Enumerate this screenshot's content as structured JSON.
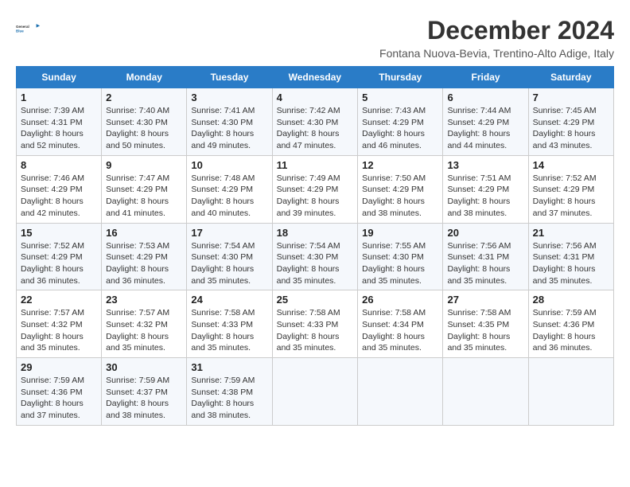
{
  "logo": {
    "line1": "General",
    "line2": "Blue"
  },
  "title": "December 2024",
  "subtitle": "Fontana Nuova-Bevia, Trentino-Alto Adige, Italy",
  "days_header": [
    "Sunday",
    "Monday",
    "Tuesday",
    "Wednesday",
    "Thursday",
    "Friday",
    "Saturday"
  ],
  "weeks": [
    [
      {
        "day": "1",
        "info": "Sunrise: 7:39 AM\nSunset: 4:31 PM\nDaylight: 8 hours\nand 52 minutes."
      },
      {
        "day": "2",
        "info": "Sunrise: 7:40 AM\nSunset: 4:30 PM\nDaylight: 8 hours\nand 50 minutes."
      },
      {
        "day": "3",
        "info": "Sunrise: 7:41 AM\nSunset: 4:30 PM\nDaylight: 8 hours\nand 49 minutes."
      },
      {
        "day": "4",
        "info": "Sunrise: 7:42 AM\nSunset: 4:30 PM\nDaylight: 8 hours\nand 47 minutes."
      },
      {
        "day": "5",
        "info": "Sunrise: 7:43 AM\nSunset: 4:29 PM\nDaylight: 8 hours\nand 46 minutes."
      },
      {
        "day": "6",
        "info": "Sunrise: 7:44 AM\nSunset: 4:29 PM\nDaylight: 8 hours\nand 44 minutes."
      },
      {
        "day": "7",
        "info": "Sunrise: 7:45 AM\nSunset: 4:29 PM\nDaylight: 8 hours\nand 43 minutes."
      }
    ],
    [
      {
        "day": "8",
        "info": "Sunrise: 7:46 AM\nSunset: 4:29 PM\nDaylight: 8 hours\nand 42 minutes."
      },
      {
        "day": "9",
        "info": "Sunrise: 7:47 AM\nSunset: 4:29 PM\nDaylight: 8 hours\nand 41 minutes."
      },
      {
        "day": "10",
        "info": "Sunrise: 7:48 AM\nSunset: 4:29 PM\nDaylight: 8 hours\nand 40 minutes."
      },
      {
        "day": "11",
        "info": "Sunrise: 7:49 AM\nSunset: 4:29 PM\nDaylight: 8 hours\nand 39 minutes."
      },
      {
        "day": "12",
        "info": "Sunrise: 7:50 AM\nSunset: 4:29 PM\nDaylight: 8 hours\nand 38 minutes."
      },
      {
        "day": "13",
        "info": "Sunrise: 7:51 AM\nSunset: 4:29 PM\nDaylight: 8 hours\nand 38 minutes."
      },
      {
        "day": "14",
        "info": "Sunrise: 7:52 AM\nSunset: 4:29 PM\nDaylight: 8 hours\nand 37 minutes."
      }
    ],
    [
      {
        "day": "15",
        "info": "Sunrise: 7:52 AM\nSunset: 4:29 PM\nDaylight: 8 hours\nand 36 minutes."
      },
      {
        "day": "16",
        "info": "Sunrise: 7:53 AM\nSunset: 4:29 PM\nDaylight: 8 hours\nand 36 minutes."
      },
      {
        "day": "17",
        "info": "Sunrise: 7:54 AM\nSunset: 4:30 PM\nDaylight: 8 hours\nand 35 minutes."
      },
      {
        "day": "18",
        "info": "Sunrise: 7:54 AM\nSunset: 4:30 PM\nDaylight: 8 hours\nand 35 minutes."
      },
      {
        "day": "19",
        "info": "Sunrise: 7:55 AM\nSunset: 4:30 PM\nDaylight: 8 hours\nand 35 minutes."
      },
      {
        "day": "20",
        "info": "Sunrise: 7:56 AM\nSunset: 4:31 PM\nDaylight: 8 hours\nand 35 minutes."
      },
      {
        "day": "21",
        "info": "Sunrise: 7:56 AM\nSunset: 4:31 PM\nDaylight: 8 hours\nand 35 minutes."
      }
    ],
    [
      {
        "day": "22",
        "info": "Sunrise: 7:57 AM\nSunset: 4:32 PM\nDaylight: 8 hours\nand 35 minutes."
      },
      {
        "day": "23",
        "info": "Sunrise: 7:57 AM\nSunset: 4:32 PM\nDaylight: 8 hours\nand 35 minutes."
      },
      {
        "day": "24",
        "info": "Sunrise: 7:58 AM\nSunset: 4:33 PM\nDaylight: 8 hours\nand 35 minutes."
      },
      {
        "day": "25",
        "info": "Sunrise: 7:58 AM\nSunset: 4:33 PM\nDaylight: 8 hours\nand 35 minutes."
      },
      {
        "day": "26",
        "info": "Sunrise: 7:58 AM\nSunset: 4:34 PM\nDaylight: 8 hours\nand 35 minutes."
      },
      {
        "day": "27",
        "info": "Sunrise: 7:58 AM\nSunset: 4:35 PM\nDaylight: 8 hours\nand 35 minutes."
      },
      {
        "day": "28",
        "info": "Sunrise: 7:59 AM\nSunset: 4:36 PM\nDaylight: 8 hours\nand 36 minutes."
      }
    ],
    [
      {
        "day": "29",
        "info": "Sunrise: 7:59 AM\nSunset: 4:36 PM\nDaylight: 8 hours\nand 37 minutes."
      },
      {
        "day": "30",
        "info": "Sunrise: 7:59 AM\nSunset: 4:37 PM\nDaylight: 8 hours\nand 38 minutes."
      },
      {
        "day": "31",
        "info": "Sunrise: 7:59 AM\nSunset: 4:38 PM\nDaylight: 8 hours\nand 38 minutes."
      },
      {
        "day": "",
        "info": ""
      },
      {
        "day": "",
        "info": ""
      },
      {
        "day": "",
        "info": ""
      },
      {
        "day": "",
        "info": ""
      }
    ]
  ]
}
